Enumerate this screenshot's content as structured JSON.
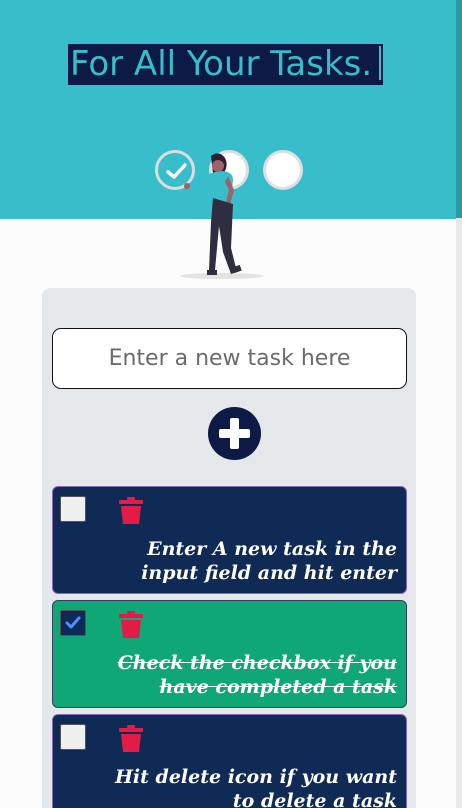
{
  "hero": {
    "headline": "For All Your Tasks."
  },
  "form": {
    "placeholder": "Enter a new task here"
  },
  "tasks": [
    {
      "text": "Enter A new task in the input field and hit enter",
      "completed": false
    },
    {
      "text": "Check the checkbox if you have completed a task",
      "completed": true
    },
    {
      "text": "Hit delete icon if you want to delete a task",
      "completed": false
    }
  ],
  "colors": {
    "hero": "#38bdca",
    "navy": "#0d1a45",
    "card_todo": "#0f2b55",
    "card_done": "#10a777",
    "trash": "#e21b47",
    "panel": "#e4e8eb"
  },
  "icons": {
    "add": "plus-icon",
    "delete": "trash-icon",
    "check": "checkmark-icon"
  }
}
